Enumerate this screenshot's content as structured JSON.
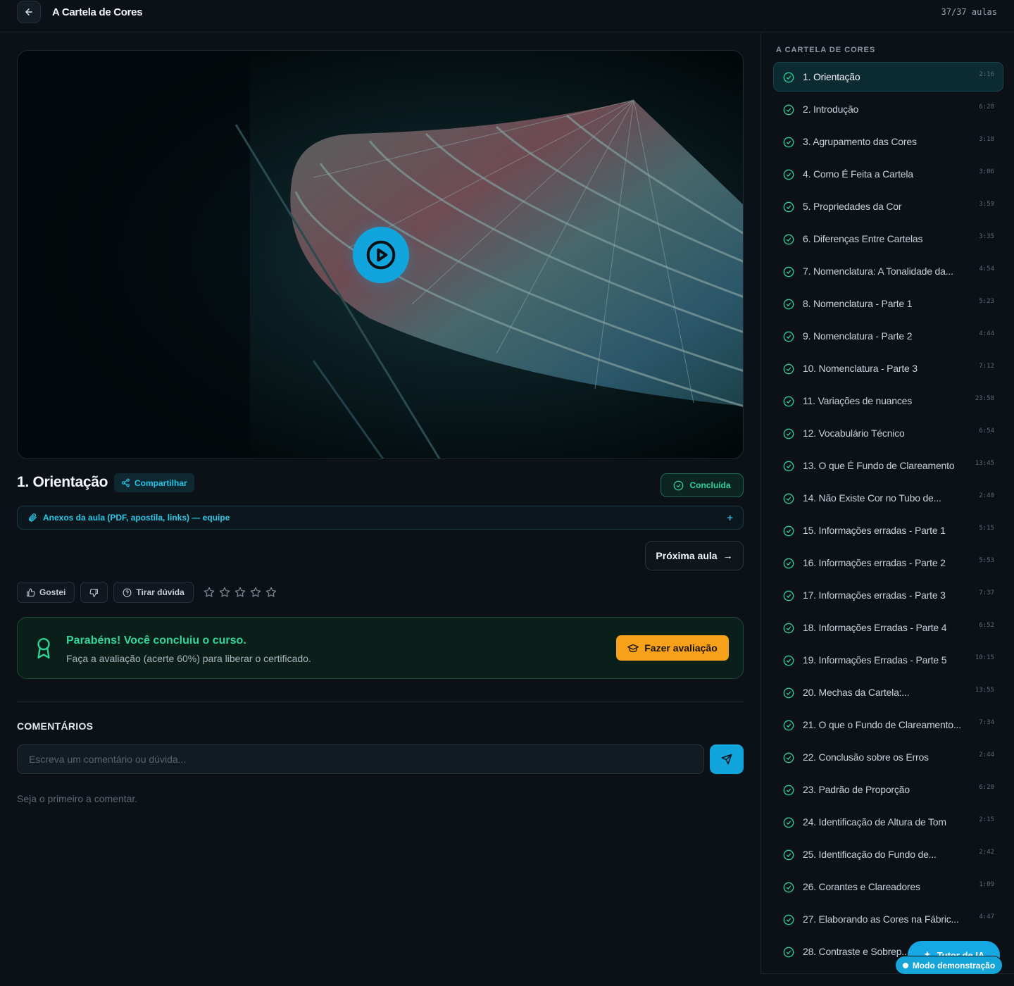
{
  "header": {
    "title": "A Cartela de Cores",
    "progress": "37/37 aulas"
  },
  "lesson": {
    "title": "1. Orientação",
    "share_label": "Compartilhar",
    "status_label": "Concluída",
    "attachments_label": "Anexos da aula (PDF, apostila, links) — equipe",
    "next_label": "Próxima aula",
    "next_arrow": "→"
  },
  "reactions": {
    "like_label": "Gostei",
    "question_label": "Tirar dúvida",
    "rating": 0,
    "rating_max": 5
  },
  "completion": {
    "title": "Parabéns! Você concluiu o curso.",
    "subtitle": "Faça a avaliação (acerte 60%) para liberar o certificado.",
    "button_label": "Fazer avaliação"
  },
  "comments": {
    "title": "COMENTÁRIOS",
    "placeholder": "Escreva um comentário ou dúvida...",
    "empty_text": "Seja o primeiro a comentar."
  },
  "sidebar": {
    "title": "A CARTELA DE CORES",
    "lessons": [
      {
        "label": "1. Orientação",
        "duration": "2:16"
      },
      {
        "label": "2. Introdução",
        "duration": "6:28"
      },
      {
        "label": "3. Agrupamento das Cores",
        "duration": "3:18"
      },
      {
        "label": "4. Como É Feita a Cartela",
        "duration": "3:06"
      },
      {
        "label": "5. Propriedades da Cor",
        "duration": "3:59"
      },
      {
        "label": "6. Diferenças Entre Cartelas",
        "duration": "3:35"
      },
      {
        "label": "7. Nomenclatura: A Tonalidade da...",
        "duration": "4:54"
      },
      {
        "label": "8. Nomenclatura - Parte 1",
        "duration": "5:23"
      },
      {
        "label": "9. Nomenclatura - Parte 2",
        "duration": "4:44"
      },
      {
        "label": "10. Nomenclatura - Parte 3",
        "duration": "7:12"
      },
      {
        "label": "11. Variações de nuances",
        "duration": "23:58"
      },
      {
        "label": "12. Vocabulário Técnico",
        "duration": "6:54"
      },
      {
        "label": "13. O que É Fundo de Clareamento",
        "duration": "13:45"
      },
      {
        "label": "14. Não Existe Cor no Tubo de...",
        "duration": "2:40"
      },
      {
        "label": "15. Informações erradas - Parte 1",
        "duration": "5:15"
      },
      {
        "label": "16. Informações erradas - Parte 2",
        "duration": "5:53"
      },
      {
        "label": "17. Informações erradas - Parte 3",
        "duration": "7:37"
      },
      {
        "label": "18. Informações Erradas - Parte 4",
        "duration": "6:52"
      },
      {
        "label": "19. Informações Erradas - Parte 5",
        "duration": "10:15"
      },
      {
        "label": "20. Mechas da Cartela:...",
        "duration": "13:55"
      },
      {
        "label": "21. O que o Fundo de Clareamento...",
        "duration": "7:34"
      },
      {
        "label": "22. Conclusão sobre os Erros",
        "duration": "2:44"
      },
      {
        "label": "23. Padrão de Proporção",
        "duration": "6:20"
      },
      {
        "label": "24. Identificação de Altura de Tom",
        "duration": "2:15"
      },
      {
        "label": "25. Identificação do Fundo de...",
        "duration": "2:42"
      },
      {
        "label": "26. Corantes e Clareadores",
        "duration": "1:09"
      },
      {
        "label": "27. Elaborando as Cores na Fábric...",
        "duration": "4:47"
      },
      {
        "label": "28. Contraste e Sobrep...",
        "duration": ""
      }
    ]
  },
  "floating": {
    "tutor_label": "Tutor de IA",
    "demo_label": "Modo demonstração"
  },
  "colors": {
    "accent": "#12a5dd",
    "success": "#2ed39a",
    "warning": "#f7a21a",
    "background": "#0b1117"
  }
}
